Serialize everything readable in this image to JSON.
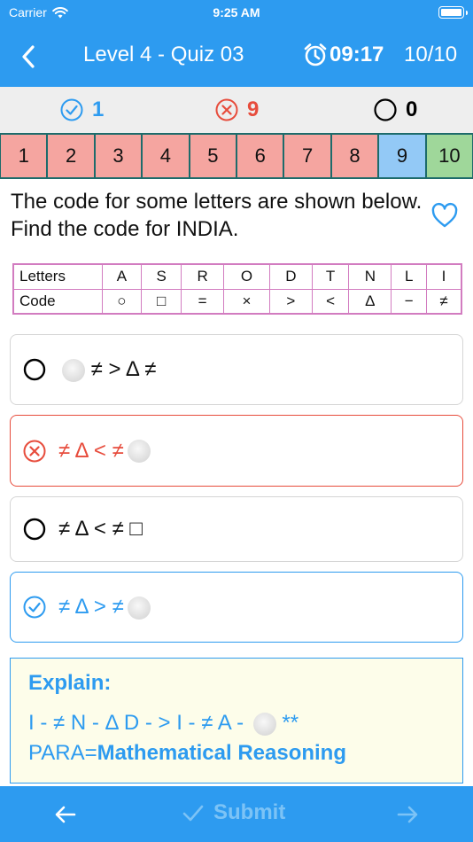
{
  "status_bar": {
    "carrier": "Carrier",
    "time": "9:25 AM"
  },
  "nav": {
    "title": "Level 4 - Quiz 03",
    "timer": "09:17",
    "progress": "10/10"
  },
  "scores": {
    "correct": "1",
    "wrong": "9",
    "skipped": "0"
  },
  "question_numbers": [
    {
      "label": "1",
      "state": "wrong"
    },
    {
      "label": "2",
      "state": "wrong"
    },
    {
      "label": "3",
      "state": "wrong"
    },
    {
      "label": "4",
      "state": "wrong"
    },
    {
      "label": "5",
      "state": "wrong"
    },
    {
      "label": "6",
      "state": "wrong"
    },
    {
      "label": "7",
      "state": "wrong"
    },
    {
      "label": "8",
      "state": "wrong"
    },
    {
      "label": "9",
      "state": "current"
    },
    {
      "label": "10",
      "state": "correct"
    }
  ],
  "question": {
    "text": "The code for some letters are shown below. Find the code for INDIA."
  },
  "code_table": {
    "letters_label": "Letters",
    "code_label": "Code",
    "letters": [
      "A",
      "S",
      "R",
      "O",
      "D",
      "T",
      "N",
      "L",
      "I"
    ],
    "codes": [
      "○",
      "□",
      "=",
      "×",
      ">",
      "<",
      "Δ",
      "−",
      "≠"
    ]
  },
  "options": [
    {
      "text": "≠ > Δ ≠",
      "state": "unselected",
      "dot": "before"
    },
    {
      "text": "≠ Δ < ≠",
      "state": "wrong",
      "dot": "after"
    },
    {
      "text": "≠ Δ < ≠ □",
      "state": "unselected",
      "dot": "none"
    },
    {
      "text": "≠ Δ > ≠",
      "state": "correct",
      "dot": "after"
    }
  ],
  "explain": {
    "title": "Explain:",
    "line1": "I - ≠ N - Δ D - > I - ≠ A -",
    "line1_suffix": "**",
    "para_prefix": "PARA=",
    "para_value": "Mathematical Reasoning"
  },
  "bottom": {
    "submit_label": "Submit"
  },
  "colors": {
    "primary": "#2d9bf0",
    "wrong": "#e74c3c",
    "wrong_bg": "#f5a5a0",
    "correct_bg": "#9fd79a",
    "current_bg": "#93c9f6"
  }
}
